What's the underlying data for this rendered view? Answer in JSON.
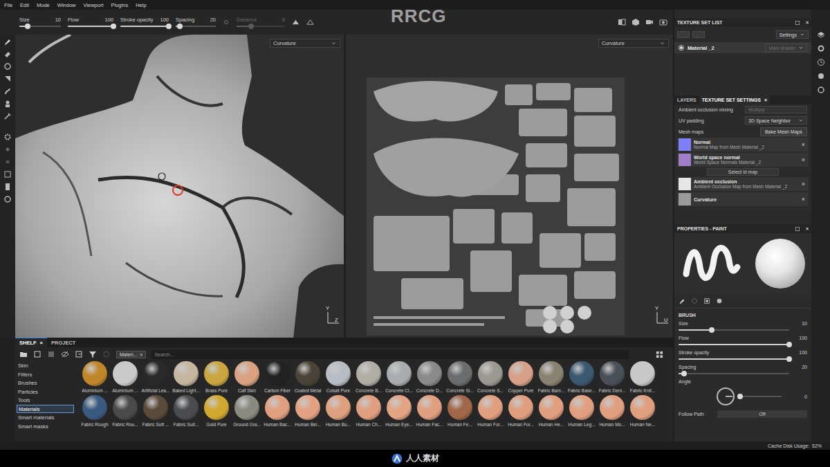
{
  "menu": [
    "File",
    "Edit",
    "Mode",
    "Window",
    "Viewport",
    "Plugins",
    "Help"
  ],
  "watermark": {
    "title": "RRCG",
    "logo": "人人素材"
  },
  "tool_options": [
    {
      "label": "Size",
      "value": "10",
      "level": 0.2,
      "disabled": false
    },
    {
      "label": "Flow",
      "value": "100",
      "level": 1,
      "disabled": false
    },
    {
      "label": "Stroke opacity",
      "value": "100",
      "level": 1,
      "disabled": false
    },
    {
      "label": "Spacing",
      "value": "20",
      "level": 0.1,
      "disabled": false
    },
    {
      "label": "Distance",
      "value": "8",
      "level": 0.3,
      "disabled": true
    }
  ],
  "viewport3d": {
    "channel": "Curvature",
    "axes": [
      "Y",
      "Z"
    ]
  },
  "viewport2d": {
    "channel": "Curvature",
    "axes": [
      "Y",
      "U"
    ]
  },
  "texture_set_list": {
    "title": "TEXTURE SET LIST",
    "close": "×",
    "settings": "Settings",
    "sets": [
      {
        "name": "Material _2",
        "shader": "Main shader",
        "selected": true
      }
    ]
  },
  "settings_panel": {
    "tabs": [
      {
        "label": "LAYERS",
        "selected": false
      },
      {
        "label": "TEXTURE SET SETTINGS",
        "selected": true
      }
    ],
    "close": "×",
    "fields": [
      {
        "label": "Ambient occlusion mixing",
        "value": "Multiply",
        "disabled": true
      },
      {
        "label": "UV padding",
        "value": "3D Space Neighbor",
        "disabled": false
      }
    ],
    "mesh_maps_label": "Mesh maps",
    "bake_button": "Bake Mesh Maps",
    "mesh_maps": [
      {
        "kind": "map",
        "name": "Normal",
        "detail": "Normal Map from Mesh Material _2",
        "color": "#7f80f5",
        "close": "×"
      },
      {
        "kind": "map",
        "name": "World space normal",
        "detail": "World Space Normals Material _2",
        "color": "#a07fc8",
        "close": "×"
      },
      {
        "kind": "button",
        "name": "Select id map"
      },
      {
        "kind": "map",
        "name": "Ambient occlusion",
        "detail": "Ambient Occlusion Map from Mesh Material _2",
        "color": "#e6e6e6",
        "close": "×"
      },
      {
        "kind": "map",
        "name": "Curvature",
        "detail": "",
        "color": "#9a9a9a",
        "close": "×"
      }
    ]
  },
  "properties": {
    "title": "PROPERTIES - PAINT",
    "close": "×",
    "section": "BRUSH",
    "params": [
      {
        "kind": "slider",
        "label": "Size",
        "value": "10",
        "level": 0.3
      },
      {
        "kind": "slider",
        "label": "Flow",
        "value": "100",
        "level": 1
      },
      {
        "kind": "slider",
        "label": "Stroke opacity",
        "value": "100",
        "level": 1
      },
      {
        "kind": "slider",
        "label": "Spacing",
        "value": "20",
        "level": 0.05
      },
      {
        "kind": "dial",
        "label": "Angle",
        "value": "0",
        "level": 0
      },
      {
        "kind": "toggle",
        "label": "Follow Path",
        "value": "Off"
      }
    ]
  },
  "shelf": {
    "tabs": [
      {
        "label": "SHELF",
        "selected": true,
        "close": "×"
      },
      {
        "label": "PROJECT",
        "selected": false,
        "close": ""
      }
    ],
    "filter_tag": {
      "label": "Materi...",
      "close": "×"
    },
    "search": {
      "placeholder": "Search..."
    },
    "categories": [
      {
        "label": "Skin",
        "selected": false
      },
      {
        "label": "Filters",
        "selected": false
      },
      {
        "label": "Brushes",
        "selected": false
      },
      {
        "label": "Particles",
        "selected": false
      },
      {
        "label": "Tools",
        "selected": false
      },
      {
        "label": "Materials",
        "selected": true
      },
      {
        "label": "Smart materials",
        "selected": false
      },
      {
        "label": "Smart masks",
        "selected": false
      }
    ],
    "materials": [
      {
        "name": "Aluminium ...",
        "color": "#c0862a"
      },
      {
        "name": "Aluminium ...",
        "color": "#c9c9c9"
      },
      {
        "name": "Artificial Lea...",
        "color": "#2a2a2a"
      },
      {
        "name": "Baked Light...",
        "color": "#c6b6a0"
      },
      {
        "name": "Brass Pure",
        "color": "#c9a640"
      },
      {
        "name": "Calf Skin",
        "color": "#dba282"
      },
      {
        "name": "Carbon Fiber",
        "color": "#222222"
      },
      {
        "name": "Coated Metal",
        "color": "#4a4438"
      },
      {
        "name": "Cobalt Pure",
        "color": "#b8bcc4"
      },
      {
        "name": "Concrete B...",
        "color": "#b0ada5"
      },
      {
        "name": "Concrete Cl...",
        "color": "#a8acae"
      },
      {
        "name": "Concrete D...",
        "color": "#8a8a8a"
      },
      {
        "name": "Concrete Si...",
        "color": "#6a6c6e"
      },
      {
        "name": "Concrete S...",
        "color": "#9a9890"
      },
      {
        "name": "Copper Pure",
        "color": "#d8a088"
      },
      {
        "name": "Fabric Bam...",
        "color": "#8a8270"
      },
      {
        "name": "Fabric Base...",
        "color": "#3a5870"
      },
      {
        "name": "Fabric Deni...",
        "color": "#4a5058"
      },
      {
        "name": "Fabric Knit...",
        "color": "#c8c8c8"
      },
      {
        "name": "Fabric Rough",
        "color": "#3a5a80"
      },
      {
        "name": "Fabric Rou...",
        "color": "#4a4a4a"
      },
      {
        "name": "Fabric Soft ...",
        "color": "#5a4a3a"
      },
      {
        "name": "Fabric Suit...",
        "color": "#4a4c50"
      },
      {
        "name": "Gold Pure",
        "color": "#d0a830"
      },
      {
        "name": "Ground Gra...",
        "color": "#8a8a80"
      },
      {
        "name": "Human Bac...",
        "color": "#e0a080"
      },
      {
        "name": "Human Bel...",
        "color": "#e2a282"
      },
      {
        "name": "Human Bu...",
        "color": "#dea07e"
      },
      {
        "name": "Human Ch...",
        "color": "#e0a080"
      },
      {
        "name": "Human Eye...",
        "color": "#e3a484"
      },
      {
        "name": "Human Fac...",
        "color": "#e0a080"
      },
      {
        "name": "Human Fe...",
        "color": "#a06848"
      },
      {
        "name": "Human For...",
        "color": "#e0a080"
      },
      {
        "name": "Human For...",
        "color": "#df9f7f"
      },
      {
        "name": "Human He...",
        "color": "#e0a080"
      },
      {
        "name": "Human Leg...",
        "color": "#e1a181"
      },
      {
        "name": "Human Mo...",
        "color": "#e0a080"
      },
      {
        "name": "Human Ne...",
        "color": "#e0a080"
      }
    ]
  },
  "status_bar": {
    "label": "Cache Disk Usage:",
    "value": "52%"
  }
}
